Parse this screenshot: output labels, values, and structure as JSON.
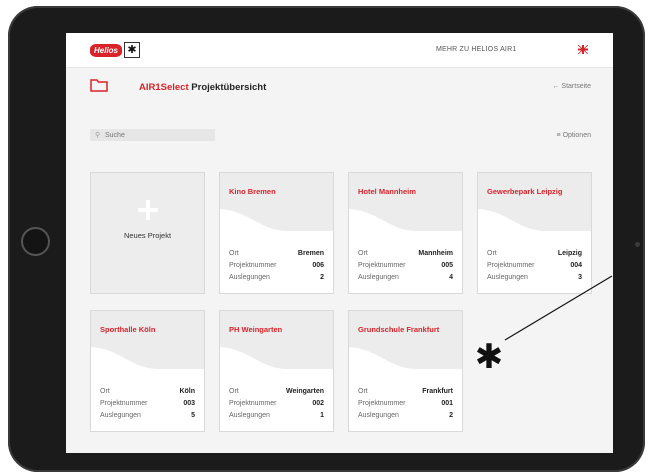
{
  "topbar": {
    "logo_text": "Helios",
    "link": "MEHR ZU HELIOS AIR1"
  },
  "header": {
    "title_accent": "AIR1Select",
    "title_rest": " Projektübersicht",
    "back": "← Startseite"
  },
  "search": {
    "placeholder": "Suche"
  },
  "options_label": "≡ Optionen",
  "new_project": {
    "label": "Neues Projekt"
  },
  "labels": {
    "location": "Ort",
    "number": "Projektnummer",
    "designs": "Auslegungen"
  },
  "projects": [
    {
      "name": "Kino Bremen",
      "location": "Bremen",
      "number": "006",
      "designs": "2"
    },
    {
      "name": "Hotel Mannheim",
      "location": "Mannheim",
      "number": "005",
      "designs": "4"
    },
    {
      "name": "Gewerbepark Leipzig",
      "location": "Leipzig",
      "number": "004",
      "designs": "3"
    },
    {
      "name": "Sporthalle Köln",
      "location": "Köln",
      "number": "003",
      "designs": "5"
    },
    {
      "name": "PH Weingarten",
      "location": "Weingarten",
      "number": "002",
      "designs": "1"
    },
    {
      "name": "Grundschule Frankfurt",
      "location": "Frankfurt",
      "number": "001",
      "designs": "2"
    }
  ],
  "colors": {
    "accent": "#d8232a",
    "background": "#f4f4f4",
    "bezel": "#1b1b1b"
  }
}
